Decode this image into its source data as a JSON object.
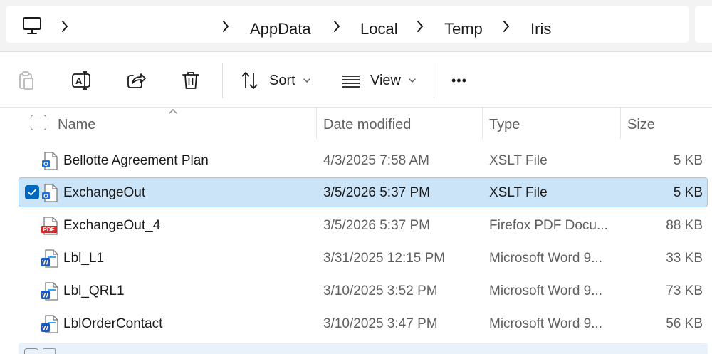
{
  "address_bar": {
    "root_icon": "computer-icon",
    "path": [
      "AppData",
      "Local",
      "Temp",
      "Iris"
    ]
  },
  "command_bar": {
    "sort_label": "Sort",
    "view_label": "View",
    "more_label": "•••",
    "icons": [
      "paste-icon",
      "rename-icon",
      "share-icon",
      "delete-icon",
      "sort-icon",
      "view-icon"
    ]
  },
  "columns": {
    "name": "Name",
    "date": "Date modified",
    "type": "Type",
    "size": "Size"
  },
  "files": [
    {
      "name": "Bellotte Agreement Plan",
      "date": "4/3/2025 7:58 AM",
      "type": "XSLT File",
      "size": "5 KB",
      "icon": "xslt-file-icon",
      "selected": false
    },
    {
      "name": "ExchangeOut",
      "date": "3/5/2026 5:37 PM",
      "type": "XSLT File",
      "size": "5 KB",
      "icon": "xslt-file-icon",
      "selected": true
    },
    {
      "name": "ExchangeOut_4",
      "date": "3/5/2026 5:37 PM",
      "type": "Firefox PDF Docu...",
      "size": "88 KB",
      "icon": "pdf-file-icon",
      "selected": false
    },
    {
      "name": "Lbl_L1",
      "date": "3/31/2025 12:15 PM",
      "type": "Microsoft Word 9...",
      "size": "33 KB",
      "icon": "word-file-icon",
      "selected": false
    },
    {
      "name": "Lbl_QRL1",
      "date": "3/10/2025 3:52 PM",
      "type": "Microsoft Word 9...",
      "size": "73 KB",
      "icon": "word-file-icon",
      "selected": false
    },
    {
      "name": "LblOrderContact",
      "date": "3/10/2025 3:47 PM",
      "type": "Microsoft Word 9...",
      "size": "56 KB",
      "icon": "word-file-icon",
      "selected": false
    }
  ],
  "colors": {
    "selection_bg": "#cce4f7",
    "selection_border": "#99c9ef",
    "accent": "#0067c0",
    "pdf_red": "#d42a2a",
    "word_blue": "#185abd"
  }
}
